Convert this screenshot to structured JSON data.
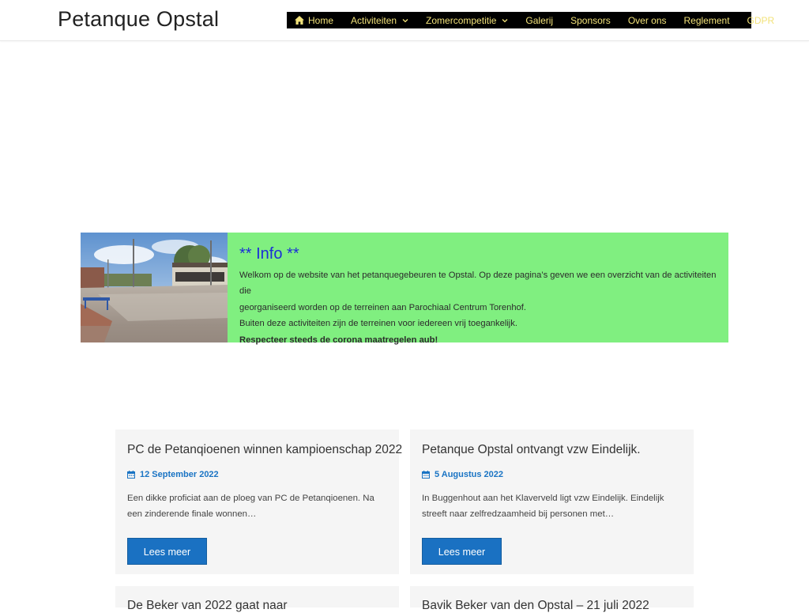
{
  "site": {
    "title": "Petanque Opstal"
  },
  "nav": {
    "items": [
      {
        "label": "Home",
        "icon": "home-icon"
      },
      {
        "label": "Activiteiten",
        "icon": "chevron-down-icon"
      },
      {
        "label": "Zomercompetitie",
        "icon": "chevron-down-icon"
      },
      {
        "label": "Galerij"
      },
      {
        "label": "Sponsors"
      },
      {
        "label": "Over ons"
      },
      {
        "label": "Reglement"
      },
      {
        "label": "GDPR"
      }
    ],
    "text_color": "#f2e27a",
    "background": "#000000"
  },
  "info": {
    "title": "** Info **",
    "line1": "Welkom op de website van het petanquegebeuren te Opstal. Op deze pagina’s geven we een overzicht van de activiteiten die",
    "line2": "georganiseerd worden op de terreinen aan Parochiaal Centrum Torenhof.",
    "line3": "Buiten deze activiteiten zijn de terreinen voor iedereen vrij toegankelijk.",
    "line4": "Respecteer steeds de corona maatregelen aub!",
    "background": "#80ef80",
    "title_color": "#1b2fd6"
  },
  "posts": [
    {
      "title": "PC de Petanqioenen winnen kampioenschap 2022",
      "date": "12 September 2022",
      "excerpt": "Een dikke proficiat aan de ploeg van PC de Petanqioenen. Na een zinderende finale wonnen…",
      "button": "Lees meer"
    },
    {
      "title": "Petanque Opstal ontvangt vzw Eindelijk.",
      "date": "5 Augustus 2022",
      "excerpt": "In Buggenhout aan het Klaverveld ligt vzw Eindelijk. Eindelijk streeft naar zelfredzaamheid bij personen met…",
      "button": "Lees meer"
    },
    {
      "title": "De Beker van 2022 gaat naar",
      "date": "",
      "excerpt": "",
      "button": ""
    },
    {
      "title": "Bavik Beker van den Opstal – 21 juli 2022",
      "date": "",
      "excerpt": "",
      "button": ""
    }
  ],
  "colors": {
    "accent": "#1a71c2",
    "date": "#1a74c4",
    "card_bg": "#f5f5f5"
  }
}
